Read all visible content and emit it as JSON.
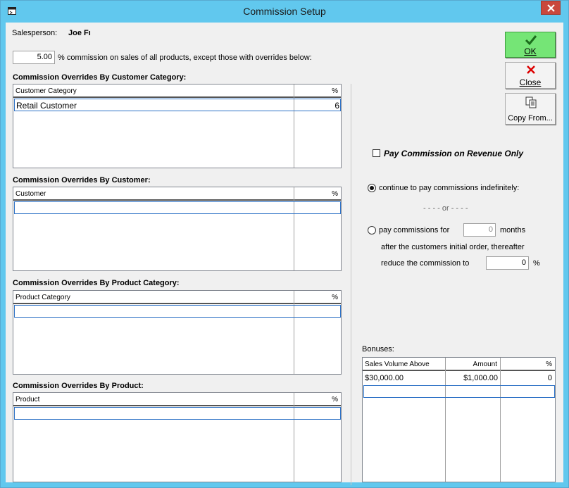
{
  "window": {
    "title": "Commission Setup"
  },
  "salesperson": {
    "label": "Salesperson:",
    "name": "Joe Fı"
  },
  "base_commission": {
    "value": "5.00",
    "text": "% commission on sales of all products, except those with overrides below:"
  },
  "overrides": {
    "customer_category": {
      "title": "Commission Overrides By Customer Category:",
      "col1": "Customer Category",
      "col2": "%",
      "rows": [
        {
          "name": "Retail Customer",
          "pct": "6"
        }
      ]
    },
    "customer": {
      "title": "Commission Overrides By Customer:",
      "col1": "Customer",
      "col2": "%"
    },
    "product_category": {
      "title": "Commission Overrides By Product Category:",
      "col1": "Product Category",
      "col2": "%"
    },
    "product": {
      "title": "Commission Overrides By Product:",
      "col1": "Product",
      "col2": "%"
    }
  },
  "buttons": {
    "ok": "OK",
    "close": "Close",
    "copy_from": "Copy From..."
  },
  "options": {
    "revenue_only": "Pay Commission on Revenue Only",
    "indefinitely": "continue to pay commissions indefinitely:",
    "or": "- - - - or - - - -",
    "pay_for": "pay commissions for",
    "months_value": "0",
    "months": "months",
    "after_text": "after the customers initial order, thereafter",
    "reduce_text": "reduce the commission to",
    "reduce_value": "0",
    "pct": "%"
  },
  "bonuses": {
    "label": "Bonuses:",
    "col1": "Sales Volume Above",
    "col2": "Amount",
    "col3": "%",
    "rows": [
      {
        "volume": "$30,000.00",
        "amount": "$1,000.00",
        "pct": "0"
      }
    ]
  }
}
